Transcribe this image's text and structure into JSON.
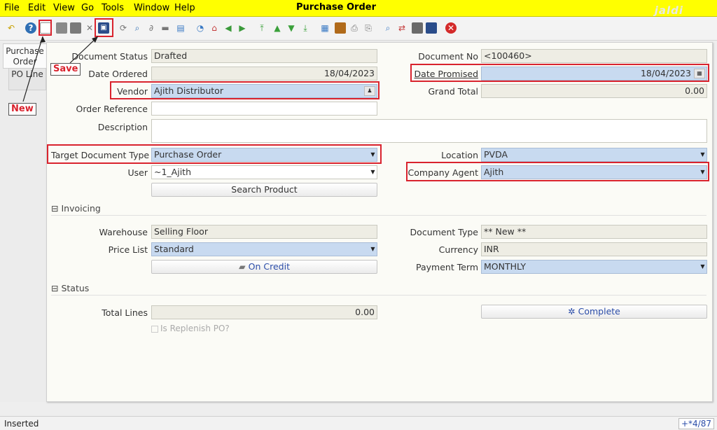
{
  "window": {
    "title": "Purchase Order",
    "brand": "jaldi"
  },
  "menu": [
    "File",
    "Edit",
    "View",
    "Go",
    "Tools",
    "Window",
    "Help"
  ],
  "toolbar_icons": [
    "undo-icon",
    "help-icon",
    "new-icon",
    "copy-icon",
    "delete-icon",
    "delete-selection-icon",
    "save-icon",
    "refresh-icon",
    "find-icon",
    "attachment-icon",
    "chat-icon",
    "history-icon",
    "home-icon",
    "back-icon",
    "forward-icon",
    "first-record-icon",
    "previous-record-icon",
    "next-record-icon",
    "last-record-icon",
    "report-icon",
    "archive-icon",
    "print-icon",
    "print-preview-icon",
    "zoom-icon",
    "workflow-icon",
    "request-icon",
    "product-info-icon",
    "exit-icon"
  ],
  "left_tabs": [
    "Purchase Order",
    "PO Line"
  ],
  "fields": {
    "document_status": {
      "label": "Document Status",
      "value": "Drafted"
    },
    "document_no": {
      "label": "Document No",
      "value": "<100460>"
    },
    "date_ordered": {
      "label": "Date Ordered",
      "value": "18/04/2023"
    },
    "date_promised": {
      "label": "Date Promised",
      "value": "18/04/2023"
    },
    "vendor": {
      "label": "Vendor",
      "value": "Ajith Distributor"
    },
    "grand_total": {
      "label": "Grand Total",
      "value": "0.00"
    },
    "order_reference": {
      "label": "Order Reference",
      "value": ""
    },
    "description": {
      "label": "Description",
      "value": ""
    },
    "target_doc_type": {
      "label": "Target Document Type",
      "value": "Purchase Order"
    },
    "location": {
      "label": "Location",
      "value": "PVDA"
    },
    "user": {
      "label": "User",
      "value": "~1_Ajith"
    },
    "company_agent": {
      "label": "Company Agent",
      "value": "Ajith"
    },
    "warehouse": {
      "label": "Warehouse",
      "value": "Selling Floor"
    },
    "document_type": {
      "label": "Document Type",
      "value": "** New **"
    },
    "price_list": {
      "label": "Price List",
      "value": "Standard"
    },
    "currency": {
      "label": "Currency",
      "value": "INR"
    },
    "payment_term": {
      "label": "Payment Term",
      "value": "MONTHLY"
    },
    "total_lines": {
      "label": "Total Lines",
      "value": "0.00"
    },
    "is_replenish": {
      "label": "Is Replenish PO?"
    }
  },
  "buttons": {
    "search_product": "Search Product",
    "on_credit": "On Credit",
    "complete": "Complete"
  },
  "sections": {
    "invoicing": "Invoicing",
    "status": "Status"
  },
  "annotations": {
    "save": "Save",
    "new": "New",
    "color": "#d9232e"
  },
  "statusbar": {
    "text": "Inserted",
    "record": "+*4/87"
  }
}
